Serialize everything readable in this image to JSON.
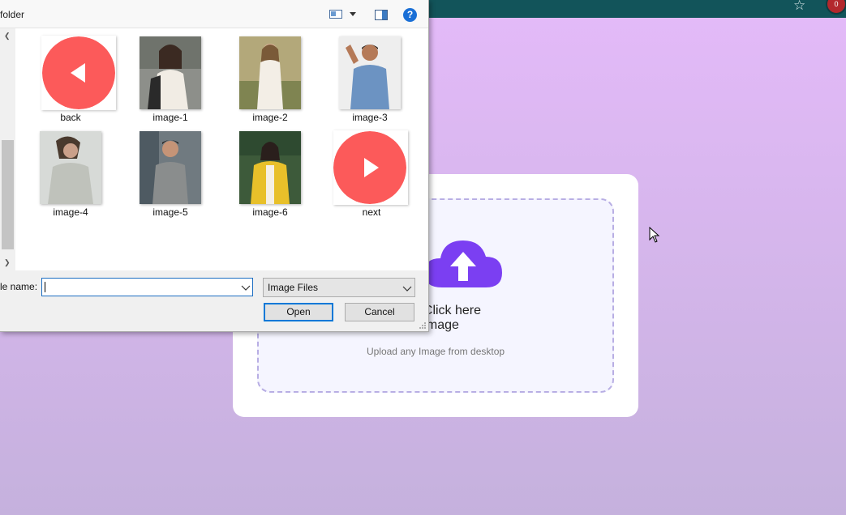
{
  "browser": {
    "bookmark_icon": "star-icon",
    "extension_badge": "0"
  },
  "upload": {
    "title_line1": "op or Click here",
    "title_line2": "d Image",
    "subtitle": "Upload any Image from desktop",
    "icon": "cloud-upload-icon",
    "accent": "#7b3ff2"
  },
  "dialog": {
    "title": "folder",
    "help": "?",
    "items": [
      {
        "label": "back",
        "type": "back-icon"
      },
      {
        "label": "image-1",
        "type": "image"
      },
      {
        "label": "image-2",
        "type": "image"
      },
      {
        "label": "image-3",
        "type": "image"
      },
      {
        "label": "image-4",
        "type": "image"
      },
      {
        "label": "image-5",
        "type": "image"
      },
      {
        "label": "image-6",
        "type": "image"
      },
      {
        "label": "next",
        "type": "next-icon"
      }
    ],
    "file_name_label": "le name:",
    "file_name_value": "",
    "file_type": "Image Files",
    "open_label": "Open",
    "cancel_label": "Cancel",
    "circle_color": "#fc5a5a"
  }
}
